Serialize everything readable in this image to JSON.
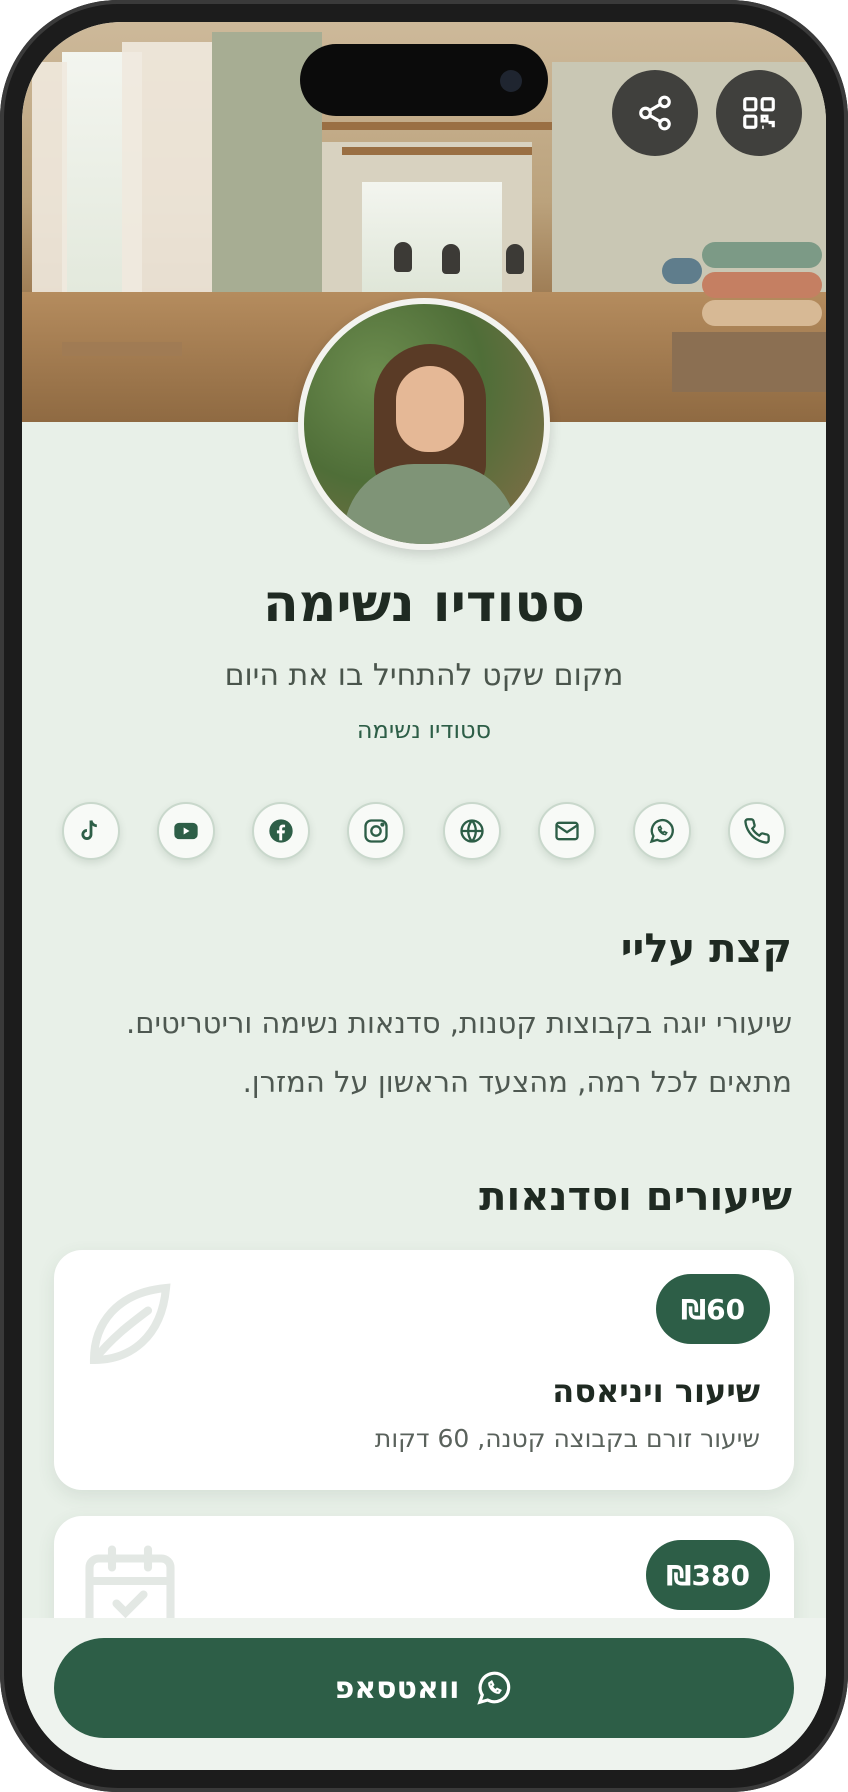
{
  "header": {
    "share_icon": "share-icon",
    "qr_icon": "qr-code-icon"
  },
  "profile": {
    "name": "סטודיו נשימה",
    "tagline": "מקום שקט להתחיל בו את היום",
    "business_name": "סטודיו נשימה"
  },
  "socials": [
    {
      "icon": "phone-icon"
    },
    {
      "icon": "whatsapp-icon"
    },
    {
      "icon": "email-icon"
    },
    {
      "icon": "globe-icon"
    },
    {
      "icon": "instagram-icon"
    },
    {
      "icon": "facebook-icon"
    },
    {
      "icon": "youtube-icon"
    },
    {
      "icon": "tiktok-icon"
    }
  ],
  "about": {
    "title": "קצת עליי",
    "text": "שיעורי יוגה בקבוצות קטנות, סדנאות נשימה וריטריטים. מתאים לכל רמה, מהצעד הראשון על המזרן."
  },
  "services": {
    "title": "שיעורים וסדנאות",
    "items": [
      {
        "price": "₪60",
        "title": "שיעור ויניאסה",
        "description": "שיעור זורם בקבוצה קטנה, 60 דקות",
        "icon": "leaf-icon"
      },
      {
        "price": "₪380",
        "title": "",
        "description": "",
        "icon": "calendar-check-icon"
      }
    ]
  },
  "cta": {
    "label": "וואטסאפ",
    "icon": "whatsapp-icon"
  },
  "colors": {
    "accent": "#2d5e47",
    "background": "#e8f0e8",
    "card": "#ffffff"
  }
}
